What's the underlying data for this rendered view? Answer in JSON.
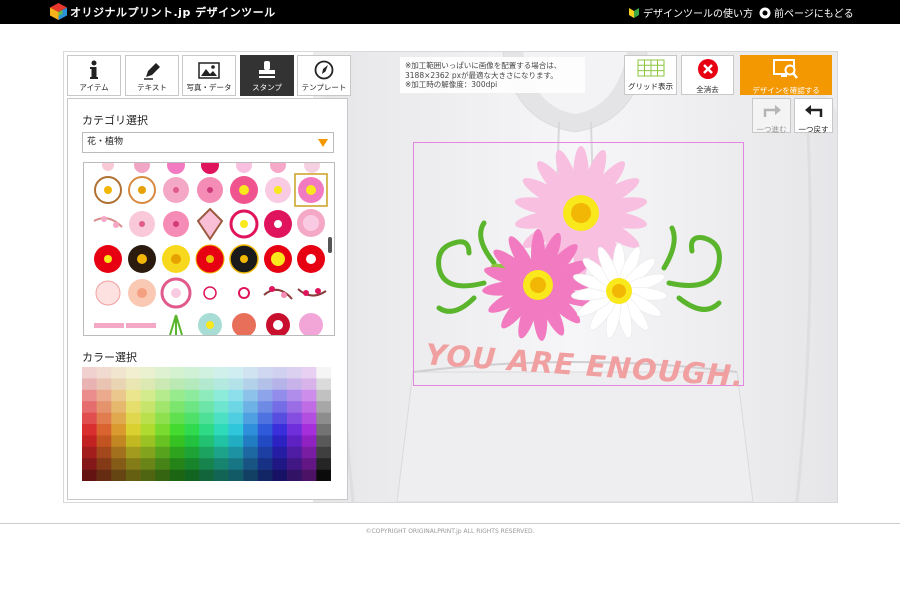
{
  "header": {
    "logo_text": "オリジナルプリント.jp デザインツール",
    "howto_link": "デザインツールの使い方",
    "back_link": "前ページにもどる"
  },
  "tabs": [
    {
      "label": "アイテム",
      "icon": "info-icon",
      "active": false
    },
    {
      "label": "テキスト",
      "icon": "pen-icon",
      "active": false
    },
    {
      "label": "写真・データ",
      "icon": "photo-icon",
      "active": false
    },
    {
      "label": "スタンプ",
      "icon": "stamp-icon",
      "active": true
    },
    {
      "label": "テンプレート",
      "icon": "compass-icon",
      "active": false
    }
  ],
  "panel": {
    "category_title": "カテゴリ選択",
    "category_value": "花・植物",
    "color_title": "カラー選択"
  },
  "notice": {
    "lines": [
      "※加工範囲いっぱいに画像を配置する場合は、",
      "3188×2362 pxが最適な大きさになります。",
      "※加工時の解像度：300dpi"
    ]
  },
  "toolbar": {
    "grid_label": "グリッド表示",
    "clear_label": "全消去",
    "confirm_label": "デザインを確認する",
    "redo_label": "一つ進む",
    "undo_label": "一つ戻す"
  },
  "design": {
    "text": "YOU ARE ENOUGH."
  },
  "footer": {
    "copyright": "©COPYRIGHT ORIGINALPRINT.jp ALL RIGHTS RESERVED."
  },
  "colors": {
    "accent": "#f39800",
    "clear_red": "#e60012",
    "active_tab": "#333333",
    "print_area": "#e387e3",
    "design_text": "#f0a0a0"
  }
}
